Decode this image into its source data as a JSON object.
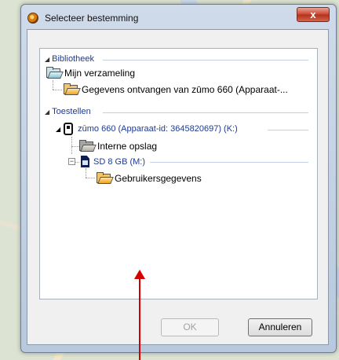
{
  "window": {
    "title": "Selecteer bestemming",
    "close_label": "x"
  },
  "tree": {
    "groups": [
      {
        "label": "Bibliotheek",
        "items": [
          {
            "label": "Mijn verzameling",
            "icon": "folder-teal-icon"
          },
          {
            "label": "Gegevens ontvangen van zūmo 660 (Apparaat-...",
            "icon": "folder-orange-icon"
          }
        ]
      },
      {
        "label": "Toestellen",
        "device": {
          "label": "zūmo 660 (Apparaat-id: 3645820697) (K:)",
          "icon": "gps-device-icon"
        },
        "items": [
          {
            "label": "Interne opslag",
            "icon": "folder-gray-icon"
          },
          {
            "label": "SD 8 GB (M:)",
            "icon": "sd-card-icon",
            "expander": "−"
          },
          {
            "label": "Gebruikersgegevens",
            "icon": "folder-orange-icon"
          }
        ]
      }
    ]
  },
  "buttons": {
    "ok_label": "OK",
    "cancel_label": "Annuleren"
  },
  "colors": {
    "accent": "#1e3a8f",
    "annotation_arrow": "#d40000"
  }
}
